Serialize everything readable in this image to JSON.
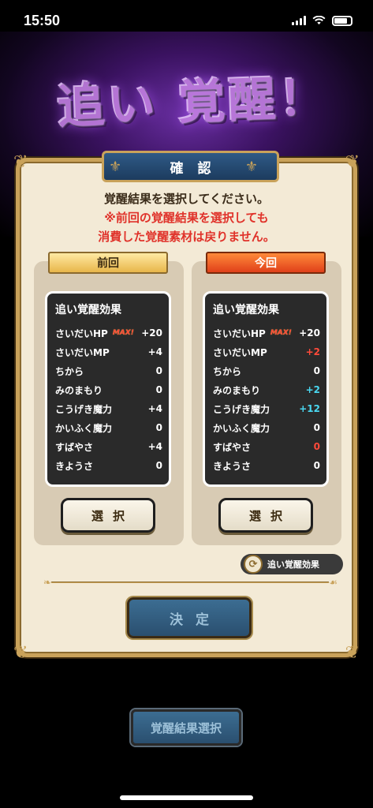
{
  "status_bar": {
    "time": "15:50"
  },
  "banner": {
    "title": "追い 覚醒！"
  },
  "dialog": {
    "title": "確認",
    "message": "覚醒結果を選択してください。",
    "warning_line1": "※前回の覚醒結果を選択しても",
    "warning_line2": "消費した覚醒素材は戻りません。"
  },
  "previous": {
    "label": "前回",
    "box_title": "追い覚醒効果",
    "stats": [
      {
        "name": "さいだいHP",
        "badge": "MAX!",
        "value": "+20"
      },
      {
        "name": "さいだいMP",
        "value": "+4"
      },
      {
        "name": "ちから",
        "value": "0"
      },
      {
        "name": "みのまもり",
        "value": "0"
      },
      {
        "name": "こうげき魔力",
        "value": "+4"
      },
      {
        "name": "かいふく魔力",
        "value": "0"
      },
      {
        "name": "すばやさ",
        "value": "+4"
      },
      {
        "name": "きようさ",
        "value": "0"
      }
    ],
    "select_label": "選択"
  },
  "current": {
    "label": "今回",
    "box_title": "追い覚醒効果",
    "stats": [
      {
        "name": "さいだいHP",
        "badge": "MAX!",
        "value": "+20"
      },
      {
        "name": "さいだいMP",
        "value": "+2"
      },
      {
        "name": "ちから",
        "value": "0"
      },
      {
        "name": "みのまもり",
        "value": "+2"
      },
      {
        "name": "こうげき魔力",
        "value": "+12"
      },
      {
        "name": "かいふく魔力",
        "value": "0"
      },
      {
        "name": "すばやさ",
        "value": "0"
      },
      {
        "name": "きようさ",
        "value": "0"
      }
    ],
    "select_label": "選択"
  },
  "toggle_chip": {
    "label": "追い覚醒効果",
    "icon": "swap-icon"
  },
  "buttons": {
    "decide": "決定",
    "awakening_select": "覚醒結果選択"
  },
  "colors": {
    "increase": "#4ad7f0",
    "decrease": "#ff4a3a",
    "warning": "#e0322a",
    "frame_gold": "#c9a25a",
    "button_blue": "#2a4f6f"
  }
}
